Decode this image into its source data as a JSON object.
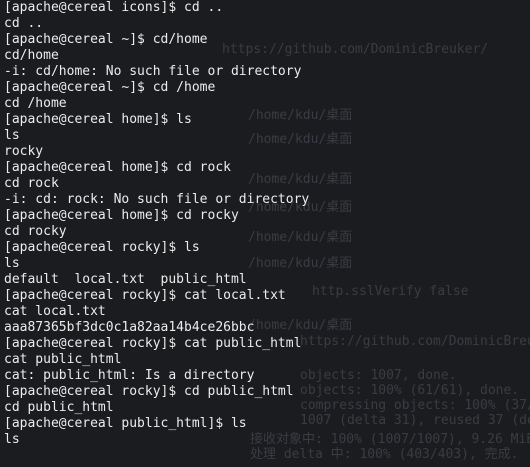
{
  "lines": [
    "[apache@cereal icons]$ cd ..",
    "cd ..",
    "[apache@cereal ~]$ cd/home",
    "cd/home",
    "-i: cd/home: No such file or directory",
    "[apache@cereal ~]$ cd /home",
    "cd /home",
    "[apache@cereal home]$ ls",
    "ls",
    "rocky",
    "[apache@cereal home]$ cd rock",
    "cd rock",
    "-i: cd: rock: No such file or directory",
    "[apache@cereal home]$ cd rocky",
    "cd rocky",
    "[apache@cereal rocky]$ ls",
    "ls",
    "default  local.txt  public_html",
    "[apache@cereal rocky]$ cat local.txt",
    "cat local.txt",
    "aaa87365bf3dc0c1a82aa14b4ce26bbc",
    "[apache@cereal rocky]$ cat public_html",
    "cat public_html",
    "cat: public_html: Is a directory",
    "[apache@cereal rocky]$ cd public_html",
    "cd public_html",
    "[apache@cereal public_html]$ ls",
    "ls"
  ],
  "background_text": [
    "https://github.com/DominicBreuker/",
    "/home/kdu/桌面",
    "/home/kdu/桌面",
    "/home/kdu/桌面",
    "/home/kdu/桌面",
    "/home/kdu/桌面",
    "/home/kdu/桌面",
    "http.sslVerify false",
    "/home/kdu/桌面",
    "https://github.com/DominicBreuker/psp",
    "objects: 1007, done.",
    "objects: 100% (61/61), done.",
    "compressing objects: 100% (37/37), done.",
    "1007 (delta 31), reused 37 (delta 21)",
    "接收对象中: 100% (1007/1007), 9.26 MiB | 230.00 KiB",
    "处理 delta 中: 100% (403/403), 完成."
  ],
  "colors": {
    "background": "#1b1c20",
    "foreground": "#ececec",
    "ghost": "#3a3c44"
  }
}
